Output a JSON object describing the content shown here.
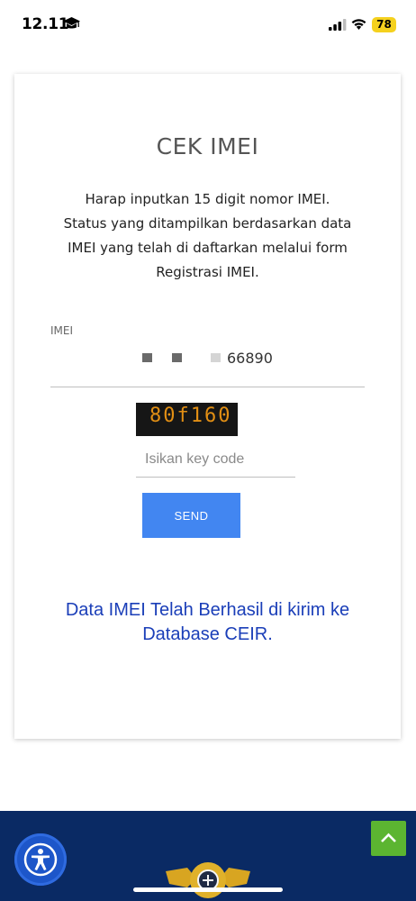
{
  "status_bar": {
    "time": "12.11",
    "battery": "78",
    "icons": [
      "graduation-cap-icon",
      "cellular-signal-icon",
      "wifi-icon",
      "battery-icon"
    ]
  },
  "card": {
    "title": "CEK IMEI",
    "description_lines": [
      "Harap inputkan 15 digit nomor IMEI.",
      "Status yang ditampilkan berdasarkan data",
      "IMEI yang telah di daftarkan melalui form",
      "Registrasi IMEI."
    ],
    "imei_label": "IMEI",
    "imei_value_visible": "66890",
    "captcha_code": "80f160",
    "keycode_placeholder": "Isikan key code",
    "send_label": "SEND",
    "result_lines": [
      "Data IMEI Telah Berhasil di kirim ke",
      "Database CEIR."
    ]
  },
  "colors": {
    "send_button": "#4286f1",
    "result_text": "#1a3eb8",
    "footer": "#0a2a64",
    "scroll_top_button": "#5cb531",
    "battery": "#f5d11e"
  },
  "footer": {
    "icons": [
      "accessibility-icon",
      "customs-emblem-logo",
      "chevron-up-icon"
    ]
  }
}
